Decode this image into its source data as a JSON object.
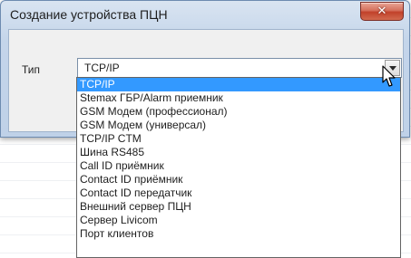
{
  "dialog": {
    "title": "Создание устройства ПЦН",
    "close_label": "✕"
  },
  "form": {
    "type_label": "Тип",
    "type_value": "TCP/IP"
  },
  "dropdown": {
    "items": [
      "TCP/IP",
      "Stemax ГБР/Alarm приемник",
      "GSM Модем (профессионал)",
      "GSM Модем (универсал)",
      "TCP/IP CTM",
      "Шина RS485",
      "Call ID приёмник",
      "Contact ID приёмник",
      "Contact ID передатчик",
      "Внешний сервер ПЦН",
      "Сервер Livicom",
      "Порт клиентов"
    ],
    "selected_index": 0
  },
  "colors": {
    "selection": "#3399ff",
    "close_button": "#c1412a"
  }
}
